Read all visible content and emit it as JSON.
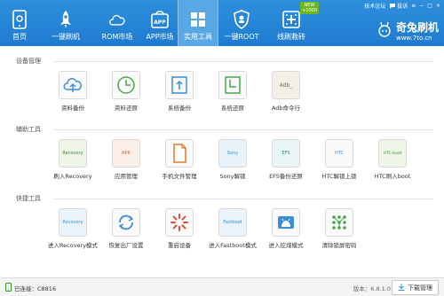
{
  "colors": {
    "brand": "#1f7bd0",
    "accent": "#5aa7e6",
    "badge": "#6fb61e",
    "status_ok": "#2ca02c"
  },
  "nav": [
    {
      "label": "首页",
      "icon": "phone-home-icon"
    },
    {
      "label": "一键刷机",
      "icon": "rocket-icon"
    },
    {
      "label": "ROM市场",
      "icon": "cloud-icon"
    },
    {
      "label": "APP市场",
      "icon": "app-bag-icon"
    },
    {
      "label": "实用工具",
      "icon": "grid-icon"
    },
    {
      "label": "一键ROOT",
      "icon": "shield-icon"
    },
    {
      "label": "线刷救砖",
      "icon": "plus-grid-icon"
    }
  ],
  "new_badge": {
    "line1": "NEW",
    "line2": "+1000"
  },
  "window_tools": {
    "speed": "技术论坛",
    "feedback": "投诉",
    "min": "−",
    "max": "□",
    "close": "×"
  },
  "brand": {
    "name": "奇兔刷机",
    "url": "www.7to.cn"
  },
  "sections": [
    {
      "title": "设备管理",
      "items": [
        {
          "label": "资料备份",
          "icon": "cloud-upload-icon"
        },
        {
          "label": "资料还原",
          "icon": "clock-restore-icon"
        },
        {
          "label": "系统备份",
          "icon": "system-backup-icon"
        },
        {
          "label": "系统还原",
          "icon": "system-restore-icon"
        },
        {
          "label": "Adb命令行",
          "icon": "adb-terminal-icon",
          "box_text": "Adb_"
        }
      ]
    },
    {
      "title": "辅助工具",
      "items": [
        {
          "label": "刷入Recovery",
          "icon": "recovery-folder-icon",
          "box_text": "Recovery"
        },
        {
          "label": "应用管理",
          "icon": "apk-folder-icon",
          "box_text": "APK"
        },
        {
          "label": "手机文件管理",
          "icon": "file-icon"
        },
        {
          "label": "Sony解锁",
          "icon": "sony-folder-icon",
          "box_text": "Sony"
        },
        {
          "label": "EFS备份还原",
          "icon": "efs-disk-icon",
          "box_text": "EFS"
        },
        {
          "label": "HTC解锁上锁",
          "icon": "htc-lock-icon",
          "box_text": "HTC"
        },
        {
          "label": "HTC刷入boot",
          "icon": "htc-boot-folder-icon",
          "box_text": "HTC-boot"
        }
      ]
    },
    {
      "title": "快捷工具",
      "items": [
        {
          "label": "进入Recovery模式",
          "icon": "recovery-mode-icon",
          "box_text": "Recovery"
        },
        {
          "label": "恢复出厂设置",
          "icon": "factory-reset-icon"
        },
        {
          "label": "重启设备",
          "icon": "reboot-icon"
        },
        {
          "label": "进入Fastboot模式",
          "icon": "fastboot-icon",
          "box_text": "Fastboot"
        },
        {
          "label": "进入挖煤模式",
          "icon": "android-mode-icon"
        },
        {
          "label": "清除锁屏密码",
          "icon": "pattern-lock-icon"
        }
      ]
    }
  ],
  "status": {
    "connection": "已连接：C8816",
    "version": "版本：6.8.1.0",
    "download": "下载管理"
  }
}
